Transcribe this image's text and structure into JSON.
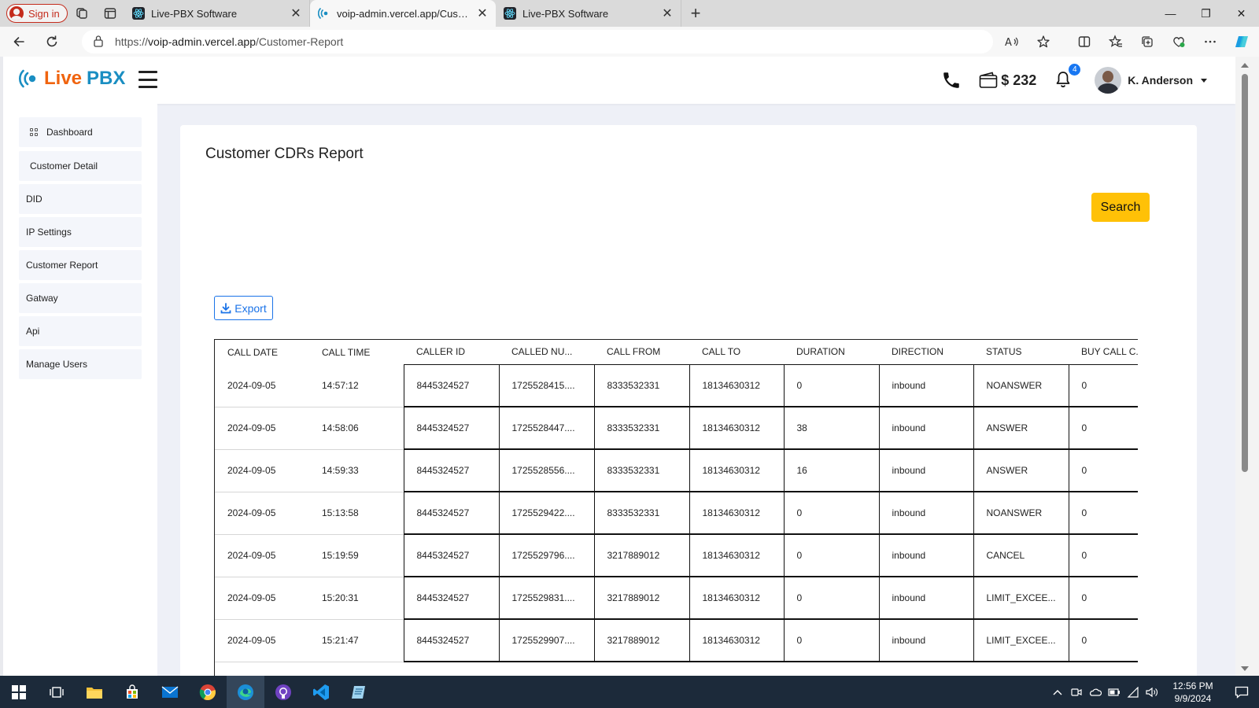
{
  "browser": {
    "signin_label": "Sign in",
    "tabs": [
      {
        "title": "Live-PBX Software",
        "active": false
      },
      {
        "title": "voip-admin.vercel.app/Customer-Report",
        "active": true
      },
      {
        "title": "Live-PBX Software",
        "active": false
      }
    ],
    "url_prefix": "https://",
    "url_host": "voip-admin.vercel.app",
    "url_path": "/Customer-Report"
  },
  "app": {
    "logo_live": "Live",
    "logo_pbx": "PBX",
    "balance": "$ 232",
    "notification_count": "4",
    "user_name": "K. Anderson"
  },
  "sidebar": {
    "items": [
      {
        "label": "Dashboard"
      },
      {
        "label": "Customer Detail"
      },
      {
        "label": "DID"
      },
      {
        "label": "IP Settings"
      },
      {
        "label": "Customer Report"
      },
      {
        "label": "Gatway"
      },
      {
        "label": "Api"
      },
      {
        "label": "Manage Users"
      }
    ]
  },
  "report": {
    "title": "Customer CDRs Report",
    "search_label": "Search",
    "export_label": "Export",
    "columns": [
      "CALL DATE",
      "CALL TIME",
      "CALLER ID",
      "CALLED NU...",
      "CALL FROM",
      "CALL TO",
      "DURATION",
      "DIRECTION",
      "STATUS",
      "BUY CALL C..."
    ],
    "rows": [
      [
        "2024-09-05",
        "14:57:12",
        "8445324527",
        "1725528415....",
        "8333532331",
        "18134630312",
        "0",
        "inbound",
        "NOANSWER",
        "0"
      ],
      [
        "2024-09-05",
        "14:58:06",
        "8445324527",
        "1725528447....",
        "8333532331",
        "18134630312",
        "38",
        "inbound",
        "ANSWER",
        "0"
      ],
      [
        "2024-09-05",
        "14:59:33",
        "8445324527",
        "1725528556....",
        "8333532331",
        "18134630312",
        "16",
        "inbound",
        "ANSWER",
        "0"
      ],
      [
        "2024-09-05",
        "15:13:58",
        "8445324527",
        "1725529422....",
        "8333532331",
        "18134630312",
        "0",
        "inbound",
        "NOANSWER",
        "0"
      ],
      [
        "2024-09-05",
        "15:19:59",
        "8445324527",
        "1725529796....",
        "3217889012",
        "18134630312",
        "0",
        "inbound",
        "CANCEL",
        "0"
      ],
      [
        "2024-09-05",
        "15:20:31",
        "8445324527",
        "1725529831....",
        "3217889012",
        "18134630312",
        "0",
        "inbound",
        "LIMIT_EXCEE...",
        "0"
      ],
      [
        "2024-09-05",
        "15:21:47",
        "8445324527",
        "1725529907....",
        "3217889012",
        "18134630312",
        "0",
        "inbound",
        "LIMIT_EXCEE...",
        "0"
      ]
    ]
  },
  "taskbar": {
    "time": "12:56 PM",
    "date": "9/9/2024"
  },
  "colors": {
    "accent_orange": "#f0640f",
    "accent_blue": "#1a8ec2",
    "search_yellow": "#ffc107",
    "export_blue": "#1a73e8"
  }
}
